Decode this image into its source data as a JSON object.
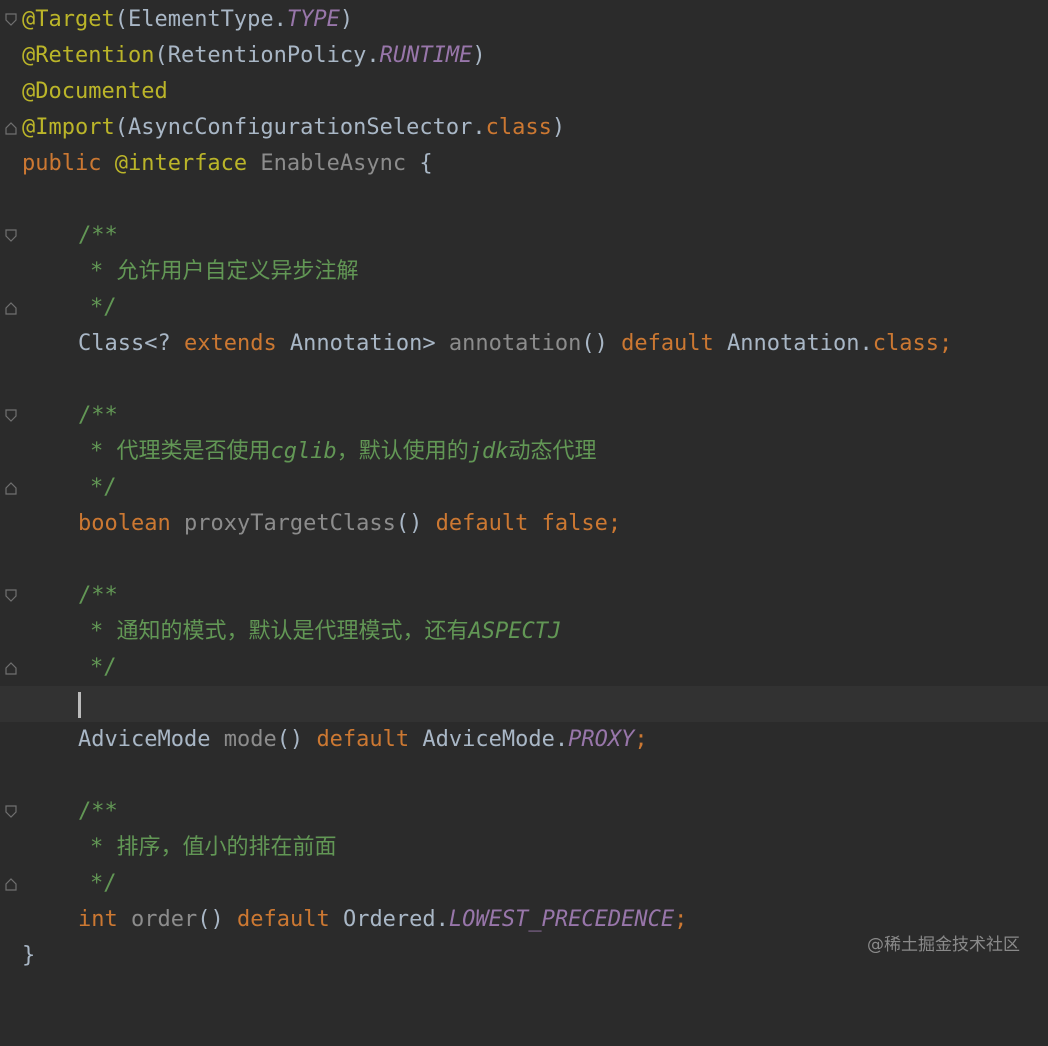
{
  "editor": {
    "lines": {
      "l1": {
        "ann": "@Target",
        "p1": "(ElementType.",
        "cst": "TYPE",
        "p2": ")"
      },
      "l2": {
        "ann": "@Retention",
        "p1": "(RetentionPolicy.",
        "cst": "RUNTIME",
        "p2": ")"
      },
      "l3": {
        "ann": "@Documented"
      },
      "l4": {
        "ann": "@Import",
        "p1": "(AsyncConfigurationSelector.",
        "kw": "class",
        "p2": ")"
      },
      "l5": {
        "kw1": "public ",
        "ann": "@interface",
        "p1": " ",
        "name": "EnableAsync",
        "p2": " {"
      },
      "c1": {
        "open": "/**",
        "text": "* 允许用户自定义异步注解",
        "close": "*/"
      },
      "m1": {
        "p1": "Class<? ",
        "kw1": "extends",
        "p2": " Annotation> ",
        "fn": "annotation",
        "p3": "() ",
        "kw2": "default",
        "p4": " Annotation.",
        "kw3": "class;"
      },
      "c2": {
        "open": "/**",
        "t1": "* 代理类是否使用",
        "t2": "cglib",
        "t3": "，默认使用的",
        "t4": "jdk",
        "t5": "动态代理",
        "close": "*/"
      },
      "m2": {
        "kw1": "boolean",
        "p1": " ",
        "fn": "proxyTargetClass",
        "p2": "() ",
        "kw2": "default",
        "p3": " ",
        "kw3": "false;"
      },
      "c3": {
        "open": "/**",
        "t1": "* 通知的模式，默认是代理模式，还有",
        "t2": "ASPECTJ",
        "close": "*/"
      },
      "m3": {
        "p1": "AdviceMode ",
        "fn": "mode",
        "p2": "() ",
        "kw1": "default",
        "p3": " AdviceMode.",
        "cst": "PROXY",
        "kw2": ";"
      },
      "c4": {
        "open": "/**",
        "text": "* 排序，值小的排在前面",
        "close": "*/"
      },
      "m4": {
        "kw1": "int",
        "p1": " ",
        "fn": "order",
        "p2": "() ",
        "kw2": "default",
        "p3": " Ordered.",
        "cst": "LOWEST_PRECEDENCE",
        "kw3": ";"
      },
      "end": {
        "brace": "}"
      }
    }
  },
  "watermark": "@稀土掘金技术社区",
  "colors": {
    "background": "#2b2b2b",
    "annotation": "#bbb529",
    "keyword": "#cc7832",
    "constant": "#9876aa",
    "comment": "#629755",
    "default_text": "#a9b7c6",
    "method_name": "#8c8c8c"
  }
}
